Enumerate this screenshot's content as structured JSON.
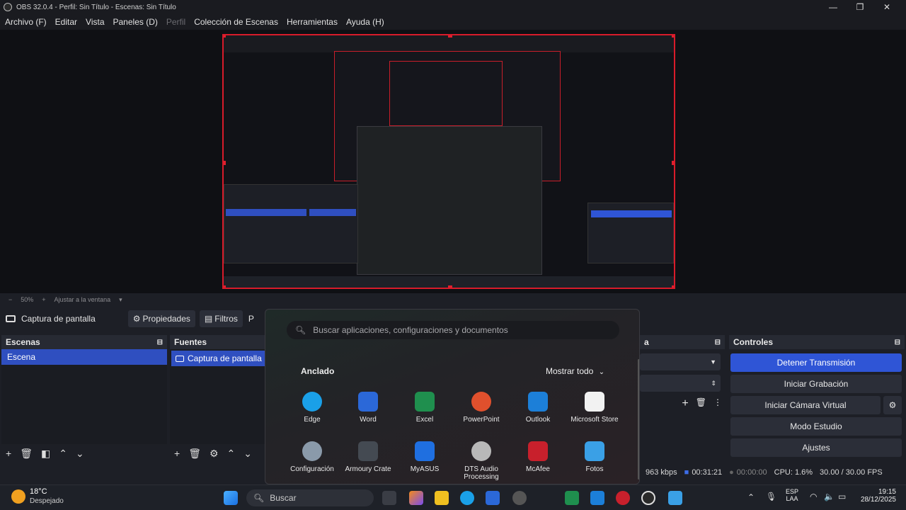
{
  "window": {
    "title": "OBS 32.0.4 - Perfil: Sin Título - Escenas: Sin Título",
    "minimize": "—",
    "maximize": "❐",
    "close": "✕"
  },
  "menu": [
    {
      "label": "Archivo (F)",
      "disabled": false
    },
    {
      "label": "Editar",
      "disabled": false
    },
    {
      "label": "Vista",
      "disabled": false
    },
    {
      "label": "Paneles (D)",
      "disabled": false
    },
    {
      "label": "Perfil",
      "disabled": true
    },
    {
      "label": "Colección de Escenas",
      "disabled": false
    },
    {
      "label": "Herramientas",
      "disabled": false
    },
    {
      "label": "Ayuda (H)",
      "disabled": false
    }
  ],
  "zoom": {
    "minus": "−",
    "value": "50%",
    "plus": "+",
    "fit": "Ajustar a la ventana",
    "caret": "▾"
  },
  "source_toolbar": {
    "source_name": "Captura de pantalla",
    "properties": "Propiedades",
    "filters": "Filtros",
    "partial": "P"
  },
  "scenes": {
    "title": "Escenas",
    "items": [
      "Escena"
    ]
  },
  "sources": {
    "title": "Fuentes",
    "items": [
      "Captura de pantalla"
    ]
  },
  "mixer": {
    "title_partial": "a"
  },
  "controls": {
    "title": "Controles",
    "buttons": [
      "Detener Transmisión",
      "Iniciar Grabación",
      "Iniciar Cámara Virtual",
      "Modo Estudio",
      "Ajustes"
    ]
  },
  "status": {
    "bitrate": "963 kbps",
    "stream_time": "00:31:21",
    "rec_time": "00:00:00",
    "cpu": "CPU: 1.6%",
    "fps": "30.00 / 30.00 FPS"
  },
  "start_menu": {
    "search_placeholder": "Buscar aplicaciones, configuraciones y documentos",
    "pinned": "Anclado",
    "show_all": "Mostrar todo",
    "apps": [
      {
        "name": "Edge",
        "color": "#1aa0e8"
      },
      {
        "name": "Word",
        "color": "#2b68d8"
      },
      {
        "name": "Excel",
        "color": "#1f8f4e"
      },
      {
        "name": "PowerPoint",
        "color": "#e0502d"
      },
      {
        "name": "Outlook",
        "color": "#1c7fd8"
      },
      {
        "name": "Microsoft Store",
        "color": "#f2f2f2"
      },
      {
        "name": "Configuración",
        "color": "#8a9aaa"
      },
      {
        "name": "Armoury Crate",
        "color": "#444a52"
      },
      {
        "name": "MyASUS",
        "color": "#1f6fe0"
      },
      {
        "name": "DTS Audio Processing",
        "color": "#b8b8b8"
      },
      {
        "name": "McAfee",
        "color": "#c8202c"
      },
      {
        "name": "Fotos",
        "color": "#3aa0e6"
      }
    ]
  },
  "taskbar": {
    "weather_temp": "18°C",
    "weather_desc": "Despejado",
    "search": "Buscar",
    "lang_top": "ESP",
    "lang_bottom": "LAA",
    "time": "19:15",
    "date": "28/12/2025"
  }
}
